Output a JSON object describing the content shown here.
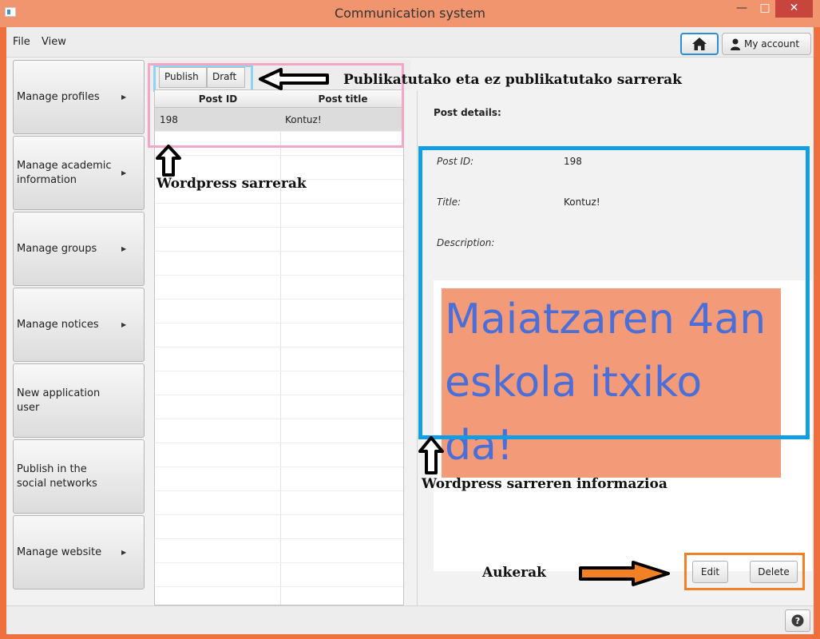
{
  "window": {
    "title": "Communication system"
  },
  "menu": {
    "file": "File",
    "view": "View"
  },
  "header": {
    "account_label": "My account"
  },
  "sidebar": {
    "items": [
      {
        "label": "Manage profiles",
        "has_arrow": true
      },
      {
        "label": "Manage academic information",
        "has_arrow": true
      },
      {
        "label": "Manage groups",
        "has_arrow": true
      },
      {
        "label": "Manage notices",
        "has_arrow": true
      },
      {
        "label": "New application user",
        "has_arrow": false
      },
      {
        "label": "Publish in the social networks",
        "has_arrow": false
      },
      {
        "label": "Manage website",
        "has_arrow": true
      }
    ]
  },
  "tabs": {
    "publish": "Publish",
    "draft": "Draft"
  },
  "table": {
    "columns": [
      "Post ID",
      "Post title"
    ],
    "rows": [
      {
        "id": "198",
        "title": "Kontuz!"
      }
    ]
  },
  "details": {
    "heading": "Post details:",
    "post_id_label": "Post ID:",
    "post_id_value": "198",
    "title_label": "Title:",
    "title_value": "Kontuz!",
    "description_label": "Description:",
    "description_text": "Maiatzaren 4an eskola itxiko da!",
    "description_highlight_color": "#f39a78",
    "description_text_color": "#4a6fd8"
  },
  "actions": {
    "edit": "Edit",
    "delete": "Delete"
  },
  "annotations": {
    "tabs_note": "Publikatutako eta ez publikatutako sarrerak",
    "table_note": "Wordpress sarrerak",
    "info_note": "Wordpress sarreren informazioa",
    "options_note": "Aukerak"
  },
  "colors": {
    "titlebar": "#f0956e",
    "tabs_highlight": "#8fd3f0",
    "table_highlight": "#f3a6c5",
    "info_highlight": "#139ee3",
    "options_highlight": "#f28024",
    "home_border": "#2d8fd1"
  },
  "icons": {
    "home": "home-icon",
    "account": "user-icon",
    "help": "help-icon"
  }
}
